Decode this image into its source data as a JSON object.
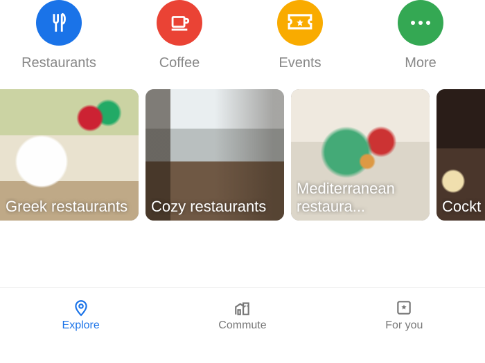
{
  "categories": [
    {
      "label": "Restaurants",
      "color": "#1a73e8",
      "icon": "restaurants-icon"
    },
    {
      "label": "Coffee",
      "color": "#ea4335",
      "icon": "coffee-icon"
    },
    {
      "label": "Events",
      "color": "#f9ab00",
      "icon": "events-icon"
    },
    {
      "label": "More",
      "color": "#34a853",
      "icon": "more-icon"
    }
  ],
  "cards": [
    {
      "label": "Greek restaurants"
    },
    {
      "label": "Cozy restaurants"
    },
    {
      "label": "Mediterranean restaura..."
    },
    {
      "label": "Cockt"
    }
  ],
  "nav": {
    "items": [
      {
        "label": "Explore",
        "active": true
      },
      {
        "label": "Commute",
        "active": false
      },
      {
        "label": "For you",
        "active": false
      }
    ]
  }
}
